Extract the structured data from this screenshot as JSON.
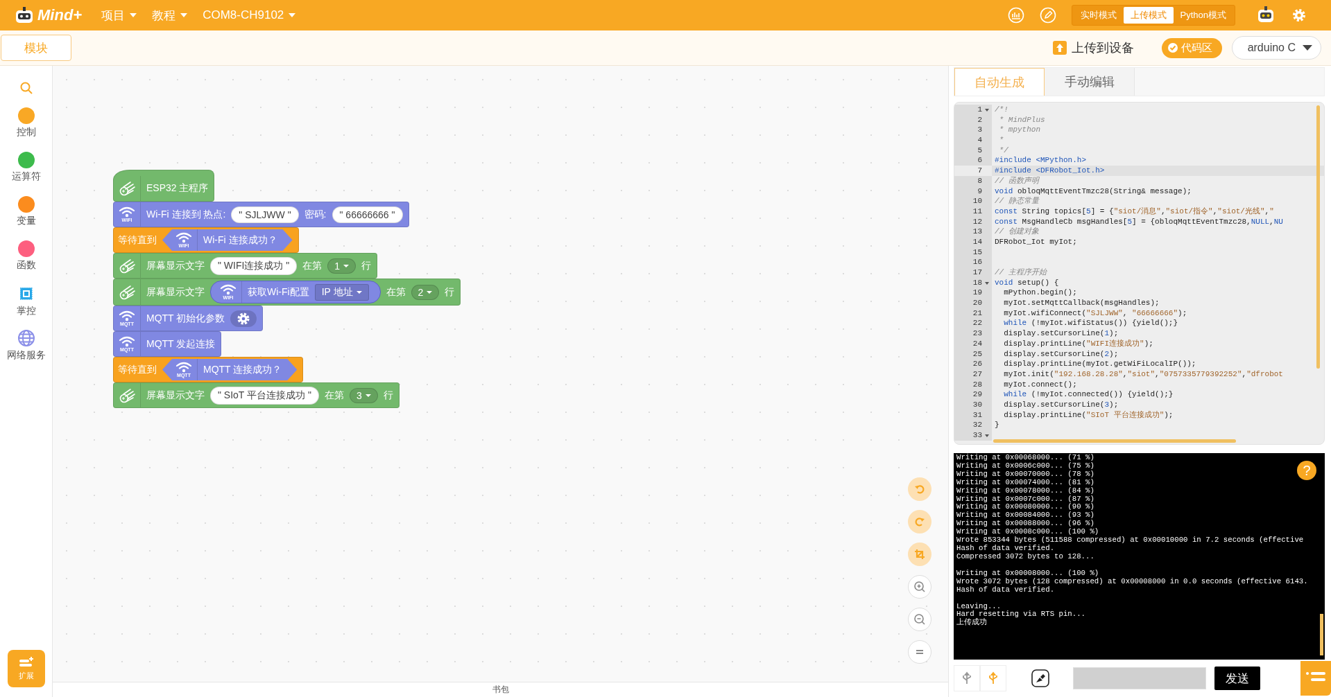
{
  "menubar": {
    "logo": "Mind+",
    "menus": [
      {
        "label": "项目"
      },
      {
        "label": "教程"
      },
      {
        "label": "COM8-CH9102"
      }
    ],
    "modes": [
      {
        "label": "实时模式",
        "selected": false
      },
      {
        "label": "上传模式",
        "selected": true
      },
      {
        "label": "Python模式",
        "selected": false
      }
    ]
  },
  "toolbar": {
    "modules_tab": "模块",
    "upload_button": "上传到设备",
    "code_toggle": {
      "label": "代码区",
      "on": true
    },
    "language": "arduino C"
  },
  "categories": [
    {
      "label": "控制",
      "kind": "dot",
      "color": "#f9a825"
    },
    {
      "label": "运算符",
      "kind": "dot",
      "color": "#3dbb4c"
    },
    {
      "label": "变量",
      "kind": "dot",
      "color": "#fb8c1e"
    },
    {
      "label": "函数",
      "kind": "dot",
      "color": "#fd5f7f"
    },
    {
      "label": "掌控",
      "kind": "chip"
    },
    {
      "label": "网络服务",
      "kind": "globe"
    }
  ],
  "extension_button": "扩展",
  "blocks": [
    {
      "kind": "hat",
      "parts": [
        {
          "kind": "text",
          "text": "ESP32 主程序"
        }
      ]
    },
    {
      "kind": "network",
      "icon_label": "WIFI",
      "parts": [
        {
          "kind": "text",
          "text": "Wi-Fi 连接到 热点:"
        },
        {
          "kind": "string",
          "text": "\" SJLJWW \""
        },
        {
          "kind": "text",
          "text": "密码:"
        },
        {
          "kind": "string",
          "text": "\" 66666666 \""
        }
      ]
    },
    {
      "kind": "wait",
      "parts": [
        {
          "kind": "text",
          "text": "等待直到"
        },
        {
          "kind": "condition",
          "icon_label": "WIFI",
          "parts": [
            {
              "kind": "text",
              "text": "Wi-Fi 连接成功？"
            }
          ]
        }
      ]
    },
    {
      "kind": "display",
      "parts": [
        {
          "kind": "text",
          "text": "屏幕显示文字"
        },
        {
          "kind": "string",
          "text": "\" WIFI连接成功 \""
        },
        {
          "kind": "text",
          "text": "在第"
        },
        {
          "kind": "dropdown",
          "text": "1"
        },
        {
          "kind": "text",
          "text": "行"
        }
      ]
    },
    {
      "kind": "display",
      "parts": [
        {
          "kind": "text",
          "text": "屏幕显示文字"
        },
        {
          "kind": "value",
          "icon_label": "WIFI",
          "parts": [
            {
              "kind": "text",
              "text": "获取Wi-Fi配置"
            },
            {
              "kind": "dropdown",
              "text": "IP 地址"
            }
          ]
        },
        {
          "kind": "text",
          "text": "在第"
        },
        {
          "kind": "dropdown",
          "text": "2"
        },
        {
          "kind": "text",
          "text": "行"
        }
      ]
    },
    {
      "kind": "network",
      "icon_label": "MQTT",
      "parts": [
        {
          "kind": "text",
          "text": "MQTT 初始化参数"
        },
        {
          "kind": "gear"
        }
      ]
    },
    {
      "kind": "network",
      "icon_label": "MQTT",
      "parts": [
        {
          "kind": "text",
          "text": "MQTT 发起连接"
        }
      ]
    },
    {
      "kind": "wait",
      "parts": [
        {
          "kind": "text",
          "text": "等待直到"
        },
        {
          "kind": "condition",
          "icon_label": "MQTT",
          "parts": [
            {
              "kind": "text",
              "text": "MQTT 连接成功？"
            }
          ]
        }
      ]
    },
    {
      "kind": "display",
      "parts": [
        {
          "kind": "text",
          "text": "屏幕显示文字"
        },
        {
          "kind": "string",
          "text": "\" SIoT 平台连接成功 \""
        },
        {
          "kind": "text",
          "text": "在第"
        },
        {
          "kind": "dropdown",
          "text": "3"
        },
        {
          "kind": "text",
          "text": "行"
        }
      ]
    }
  ],
  "backpack": "书包",
  "code_tabs": [
    {
      "label": "自动生成",
      "selected": true
    },
    {
      "label": "手动编辑",
      "selected": false
    }
  ],
  "code_lines": [
    {
      "number": "1",
      "foldable": true,
      "active": false,
      "segments": [
        {
          "kind": "comment",
          "text": "/*!"
        }
      ]
    },
    {
      "number": "2",
      "foldable": false,
      "active": false,
      "segments": [
        {
          "kind": "comment",
          "text": " * MindPlus"
        }
      ]
    },
    {
      "number": "3",
      "foldable": false,
      "active": false,
      "segments": [
        {
          "kind": "comment",
          "text": " * mpython"
        }
      ]
    },
    {
      "number": "4",
      "foldable": false,
      "active": false,
      "segments": [
        {
          "kind": "comment",
          "text": " *"
        }
      ]
    },
    {
      "number": "5",
      "foldable": false,
      "active": false,
      "segments": [
        {
          "kind": "comment",
          "text": " */"
        }
      ]
    },
    {
      "number": "6",
      "foldable": false,
      "active": false,
      "segments": [
        {
          "kind": "keyword",
          "text": "#include <MPython.h>"
        }
      ]
    },
    {
      "number": "7",
      "foldable": false,
      "active": true,
      "segments": [
        {
          "kind": "keyword",
          "text": "#include <DFRobot_Iot.h>"
        }
      ]
    },
    {
      "number": "8",
      "foldable": false,
      "active": false,
      "segments": [
        {
          "kind": "comment",
          "text": "// 函数声明"
        }
      ]
    },
    {
      "number": "9",
      "foldable": false,
      "active": false,
      "segments": [
        {
          "kind": "keyword",
          "text": "void"
        },
        {
          "kind": "plain",
          "text": " obloqMqttEventTmzc28(String& message);"
        }
      ]
    },
    {
      "number": "10",
      "foldable": false,
      "active": false,
      "segments": [
        {
          "kind": "comment",
          "text": "// 静态常量"
        }
      ]
    },
    {
      "number": "11",
      "foldable": false,
      "active": false,
      "segments": [
        {
          "kind": "keyword",
          "text": "const"
        },
        {
          "kind": "plain",
          "text": " String topics["
        },
        {
          "kind": "number",
          "text": "5"
        },
        {
          "kind": "plain",
          "text": "] = {"
        },
        {
          "kind": "string",
          "text": "\"siot/消息\""
        },
        {
          "kind": "plain",
          "text": ","
        },
        {
          "kind": "string",
          "text": "\"siot/指令\""
        },
        {
          "kind": "plain",
          "text": ","
        },
        {
          "kind": "string",
          "text": "\"siot/光线\""
        },
        {
          "kind": "plain",
          "text": ","
        },
        {
          "kind": "string",
          "text": "\""
        }
      ]
    },
    {
      "number": "12",
      "foldable": false,
      "active": false,
      "segments": [
        {
          "kind": "keyword",
          "text": "const"
        },
        {
          "kind": "plain",
          "text": " MsgHandleCb msgHandles["
        },
        {
          "kind": "number",
          "text": "5"
        },
        {
          "kind": "plain",
          "text": "] = {obloqMqttEventTmzc28,"
        },
        {
          "kind": "keyword",
          "text": "NULL"
        },
        {
          "kind": "plain",
          "text": ","
        },
        {
          "kind": "keyword",
          "text": "NU"
        }
      ]
    },
    {
      "number": "13",
      "foldable": false,
      "active": false,
      "segments": [
        {
          "kind": "comment",
          "text": "// 创建对象"
        }
      ]
    },
    {
      "number": "14",
      "foldable": false,
      "active": false,
      "segments": [
        {
          "kind": "plain",
          "text": "DFRobot_Iot myIot;"
        }
      ]
    },
    {
      "number": "15",
      "foldable": false,
      "active": false
    },
    {
      "number": "16",
      "foldable": false,
      "active": false
    },
    {
      "number": "17",
      "foldable": false,
      "active": false,
      "segments": [
        {
          "kind": "comment",
          "text": "// 主程序开始"
        }
      ]
    },
    {
      "number": "18",
      "foldable": true,
      "active": false,
      "segments": [
        {
          "kind": "keyword",
          "text": "void"
        },
        {
          "kind": "plain",
          "text": " setup() {"
        }
      ]
    },
    {
      "number": "19",
      "foldable": false,
      "active": false,
      "segments": [
        {
          "kind": "plain",
          "text": "  mPython.begin();"
        }
      ]
    },
    {
      "number": "20",
      "foldable": false,
      "active": false,
      "segments": [
        {
          "kind": "plain",
          "text": "  myIot.setMqttCallback(msgHandles);"
        }
      ]
    },
    {
      "number": "21",
      "foldable": false,
      "active": false,
      "segments": [
        {
          "kind": "plain",
          "text": "  myIot.wifiConnect("
        },
        {
          "kind": "string",
          "text": "\"SJLJWW\""
        },
        {
          "kind": "plain",
          "text": ", "
        },
        {
          "kind": "string",
          "text": "\"66666666\""
        },
        {
          "kind": "plain",
          "text": ");"
        }
      ]
    },
    {
      "number": "22",
      "foldable": false,
      "active": false,
      "indented": true,
      "segments": [
        {
          "kind": "keyword",
          "text": "while"
        },
        {
          "kind": "plain",
          "text": " (!myIot.wifiStatus()) {yield();}"
        }
      ]
    },
    {
      "number": "23",
      "foldable": false,
      "active": false,
      "segments": [
        {
          "kind": "plain",
          "text": "  display.setCursorLine("
        },
        {
          "kind": "number",
          "text": "1"
        },
        {
          "kind": "plain",
          "text": ");"
        }
      ]
    },
    {
      "number": "24",
      "foldable": false,
      "active": false,
      "segments": [
        {
          "kind": "plain",
          "text": "  display.printLine("
        },
        {
          "kind": "string",
          "text": "\"WIFI连接成功\""
        },
        {
          "kind": "plain",
          "text": ");"
        }
      ]
    },
    {
      "number": "25",
      "foldable": false,
      "active": false,
      "segments": [
        {
          "kind": "plain",
          "text": "  display.setCursorLine("
        },
        {
          "kind": "number",
          "text": "2"
        },
        {
          "kind": "plain",
          "text": ");"
        }
      ]
    },
    {
      "number": "26",
      "foldable": false,
      "active": false,
      "segments": [
        {
          "kind": "plain",
          "text": "  display.printLine(myIot.getWiFiLocalIP());"
        }
      ]
    },
    {
      "number": "27",
      "foldable": false,
      "active": false,
      "segments": [
        {
          "kind": "plain",
          "text": "  myIot.init("
        },
        {
          "kind": "string",
          "text": "\"192.168.28.28\""
        },
        {
          "kind": "plain",
          "text": ","
        },
        {
          "kind": "string",
          "text": "\"siot\""
        },
        {
          "kind": "plain",
          "text": ","
        },
        {
          "kind": "string",
          "text": "\"0757335779392252\""
        },
        {
          "kind": "plain",
          "text": ","
        },
        {
          "kind": "string",
          "text": "\"dfrobot"
        }
      ]
    },
    {
      "number": "28",
      "foldable": false,
      "active": false,
      "segments": [
        {
          "kind": "plain",
          "text": "  myIot.connect();"
        }
      ]
    },
    {
      "number": "29",
      "foldable": false,
      "active": false,
      "indented": true,
      "segments": [
        {
          "kind": "keyword",
          "text": "while"
        },
        {
          "kind": "plain",
          "text": " (!myIot.connected()) {yield();}"
        }
      ]
    },
    {
      "number": "30",
      "foldable": false,
      "active": false,
      "segments": [
        {
          "kind": "plain",
          "text": "  display.setCursorLine("
        },
        {
          "kind": "number",
          "text": "3"
        },
        {
          "kind": "plain",
          "text": ");"
        }
      ]
    },
    {
      "number": "31",
      "foldable": false,
      "active": false,
      "segments": [
        {
          "kind": "plain",
          "text": "  display.printLine("
        },
        {
          "kind": "string",
          "text": "\"SIoT 平台连接成功\""
        },
        {
          "kind": "plain",
          "text": ");"
        }
      ]
    },
    {
      "number": "32",
      "foldable": false,
      "active": false,
      "segments": [
        {
          "kind": "plain",
          "text": "}"
        }
      ]
    },
    {
      "number": "33",
      "foldable": true,
      "active": false
    }
  ],
  "console": {
    "help_button": "?",
    "paragraphs": [
      [
        "Writing at 0x00068000... (71 %)",
        "Writing at 0x0006c000... (75 %)",
        "Writing at 0x00070000... (78 %)",
        "Writing at 0x00074000... (81 %)",
        "Writing at 0x00078000... (84 %)",
        "Writing at 0x0007c000... (87 %)",
        "Writing at 0x00080000... (90 %)",
        "Writing at 0x00084000... (93 %)",
        "Writing at 0x00088000... (96 %)",
        "Writing at 0x0008c000... (100 %)",
        "Wrote 853344 bytes (511588 compressed) at 0x00010000 in 7.2 seconds (effective",
        "Hash of data verified.",
        "Compressed 3072 bytes to 128..."
      ],
      [
        "Writing at 0x00008000... (100 %)",
        "Wrote 3072 bytes (128 compressed) at 0x00008000 in 0.0 seconds (effective 6143.",
        "Hash of data verified."
      ],
      [
        "Leaving...",
        "Hard resetting via RTS pin...",
        "上传成功"
      ]
    ]
  },
  "serial": {
    "send_button": "发送"
  }
}
